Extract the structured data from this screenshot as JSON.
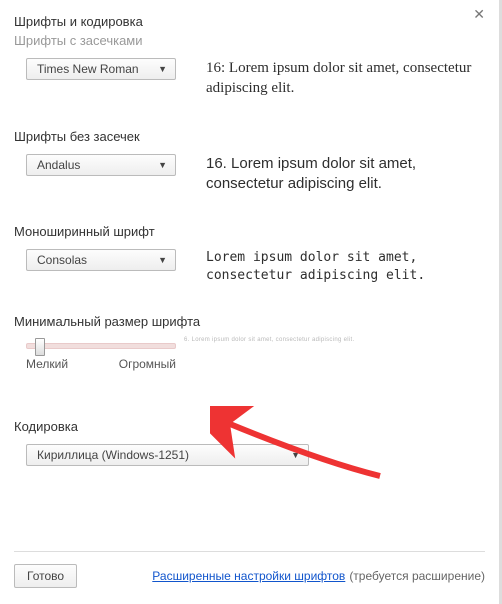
{
  "dialog": {
    "title": "Шрифты и кодировка",
    "close_glyph": "✕"
  },
  "serif": {
    "label": "Шрифты с засечками",
    "value": "Times New Roman",
    "sample": "16: Lorem ipsum dolor sit amet, consectetur adipiscing elit."
  },
  "sans": {
    "label": "Шрифты без засечек",
    "value": "Andalus",
    "sample": "16. Lorem ipsum dolor sit amet, consectetur adipiscing elit."
  },
  "mono": {
    "label": "Моноширинный шрифт",
    "value": "Consolas",
    "sample": "Lorem ipsum dolor sit amet, consectetur adipiscing elit."
  },
  "minsize": {
    "label": "Минимальный размер шрифта",
    "min_label": "Мелкий",
    "max_label": "Огромный",
    "sample": "6. Lorem ipsum dolor sit amet, consectetur adipiscing elit."
  },
  "encoding": {
    "label": "Кодировка",
    "value": "Кириллица (Windows-1251)"
  },
  "footer": {
    "done": "Готово",
    "link": "Расширенные настройки шрифтов",
    "hint": "(требуется расширение)"
  }
}
